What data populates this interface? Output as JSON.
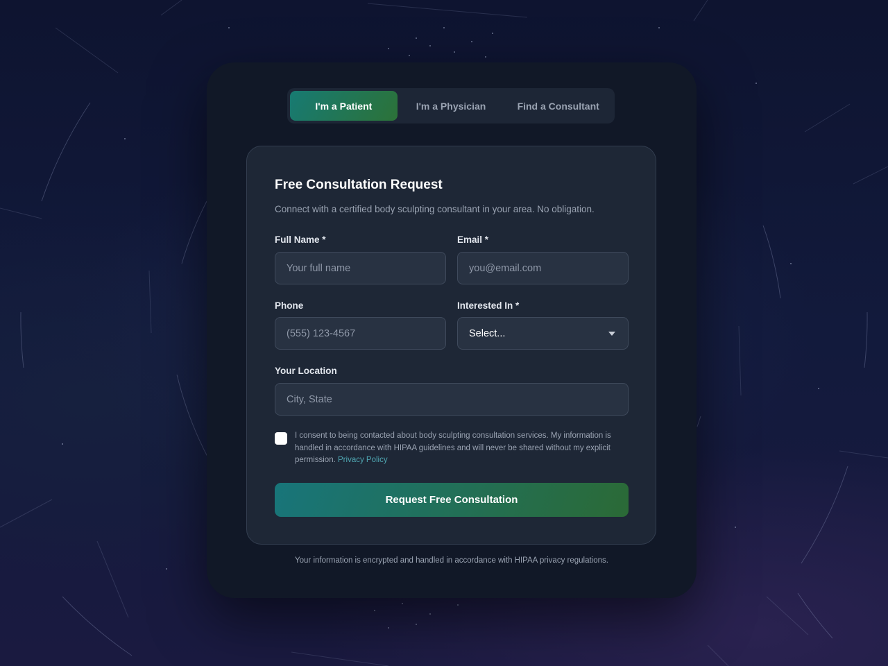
{
  "tabs": [
    {
      "label": "I'm a Patient",
      "active": true
    },
    {
      "label": "I'm a Physician",
      "active": false
    },
    {
      "label": "Find a Consultant",
      "active": false
    }
  ],
  "form": {
    "title": "Free Consultation Request",
    "subtitle": "Connect with a certified body sculpting consultant in your area. No obligation.",
    "full_name": {
      "label": "Full Name *",
      "placeholder": "Your full name"
    },
    "email": {
      "label": "Email *",
      "placeholder": "you@email.com"
    },
    "phone": {
      "label": "Phone",
      "placeholder": "(555) 123-4567"
    },
    "interest": {
      "label": "Interested In *",
      "selected": "Select..."
    },
    "location": {
      "label": "Your Location",
      "placeholder": "City, State"
    },
    "consent": {
      "text": "I consent to being contacted about body sculpting consultation services. My information is handled in accordance with HIPAA guidelines and will never be shared without my explicit permission.",
      "link": "Privacy Policy",
      "checked": false
    },
    "submit_label": "Request Free Consultation"
  },
  "footer_note": "Your information is encrypted and handled in accordance with HIPAA privacy regulations.",
  "colors": {
    "accent_start": "#177a73",
    "accent_end": "#2c7238",
    "link": "#4fa6b2",
    "card_bg": "#111827",
    "form_bg": "#1e2736"
  },
  "icons": {
    "select_caret": "chevron-down-icon"
  }
}
